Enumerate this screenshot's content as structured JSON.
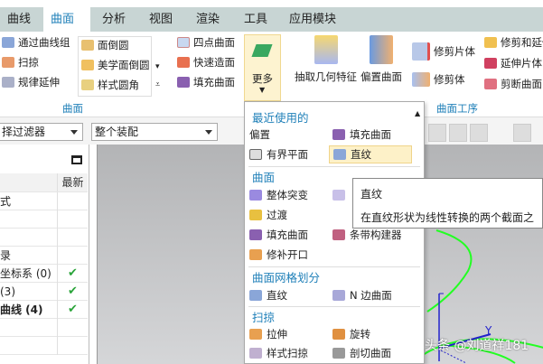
{
  "tabs": [
    "曲线",
    "曲面",
    "分析",
    "视图",
    "渲染",
    "工具",
    "应用模块"
  ],
  "ribbon": {
    "col1": [
      "通过曲线组",
      "扫掠",
      "规律延伸"
    ],
    "col2": [
      "面倒圆",
      "美学面倒圆",
      "样式圆角"
    ],
    "col3": [
      "四点曲面",
      "快速造面",
      "填充曲面"
    ],
    "more": "更多",
    "big": [
      "抽取几何特征",
      "偏置曲面"
    ],
    "col4": [
      "修剪片体",
      "修剪体"
    ],
    "col5": [
      "修剪和延伸",
      "延伸片体",
      "剪断曲面"
    ],
    "group1": "曲面",
    "group2": "曲面工序"
  },
  "toolbar": {
    "filter": "择过滤器",
    "assembly": "整个装配"
  },
  "left_panel": {
    "col_header": "最新",
    "rows": [
      {
        "name": "式",
        "latest": ""
      },
      {
        "name": "",
        "latest": ""
      },
      {
        "name": "",
        "latest": ""
      },
      {
        "name": "录",
        "latest": ""
      },
      {
        "name": "坐标系 (0)",
        "latest": "✔"
      },
      {
        "name": " (3)",
        "latest": "✔"
      },
      {
        "name": "曲线 (4)",
        "latest": "✔"
      },
      {
        "name": "",
        "latest": ""
      },
      {
        "name": "",
        "latest": ""
      }
    ]
  },
  "menu": {
    "recent": "最近使用的",
    "recent_items": [
      "偏置",
      "填充曲面",
      "有界平面",
      "直纹"
    ],
    "surface": "曲面",
    "surface_items": [
      "整体突变",
      "过渡",
      "填充曲面",
      "条带构建器",
      "修补开口"
    ],
    "mesh": "曲面网格划分",
    "mesh_items": [
      "直纹",
      "N 边曲面"
    ],
    "sweep": "扫掠",
    "sweep_items": [
      "拉伸",
      "旋转",
      "样式扫掠",
      "剖切曲面"
    ]
  },
  "tooltip": {
    "title": "直纹",
    "desc": "在直纹形状为线性转换的两个截面之间"
  },
  "watermark": "头条 @刘道祥181",
  "axis_label": "Y"
}
